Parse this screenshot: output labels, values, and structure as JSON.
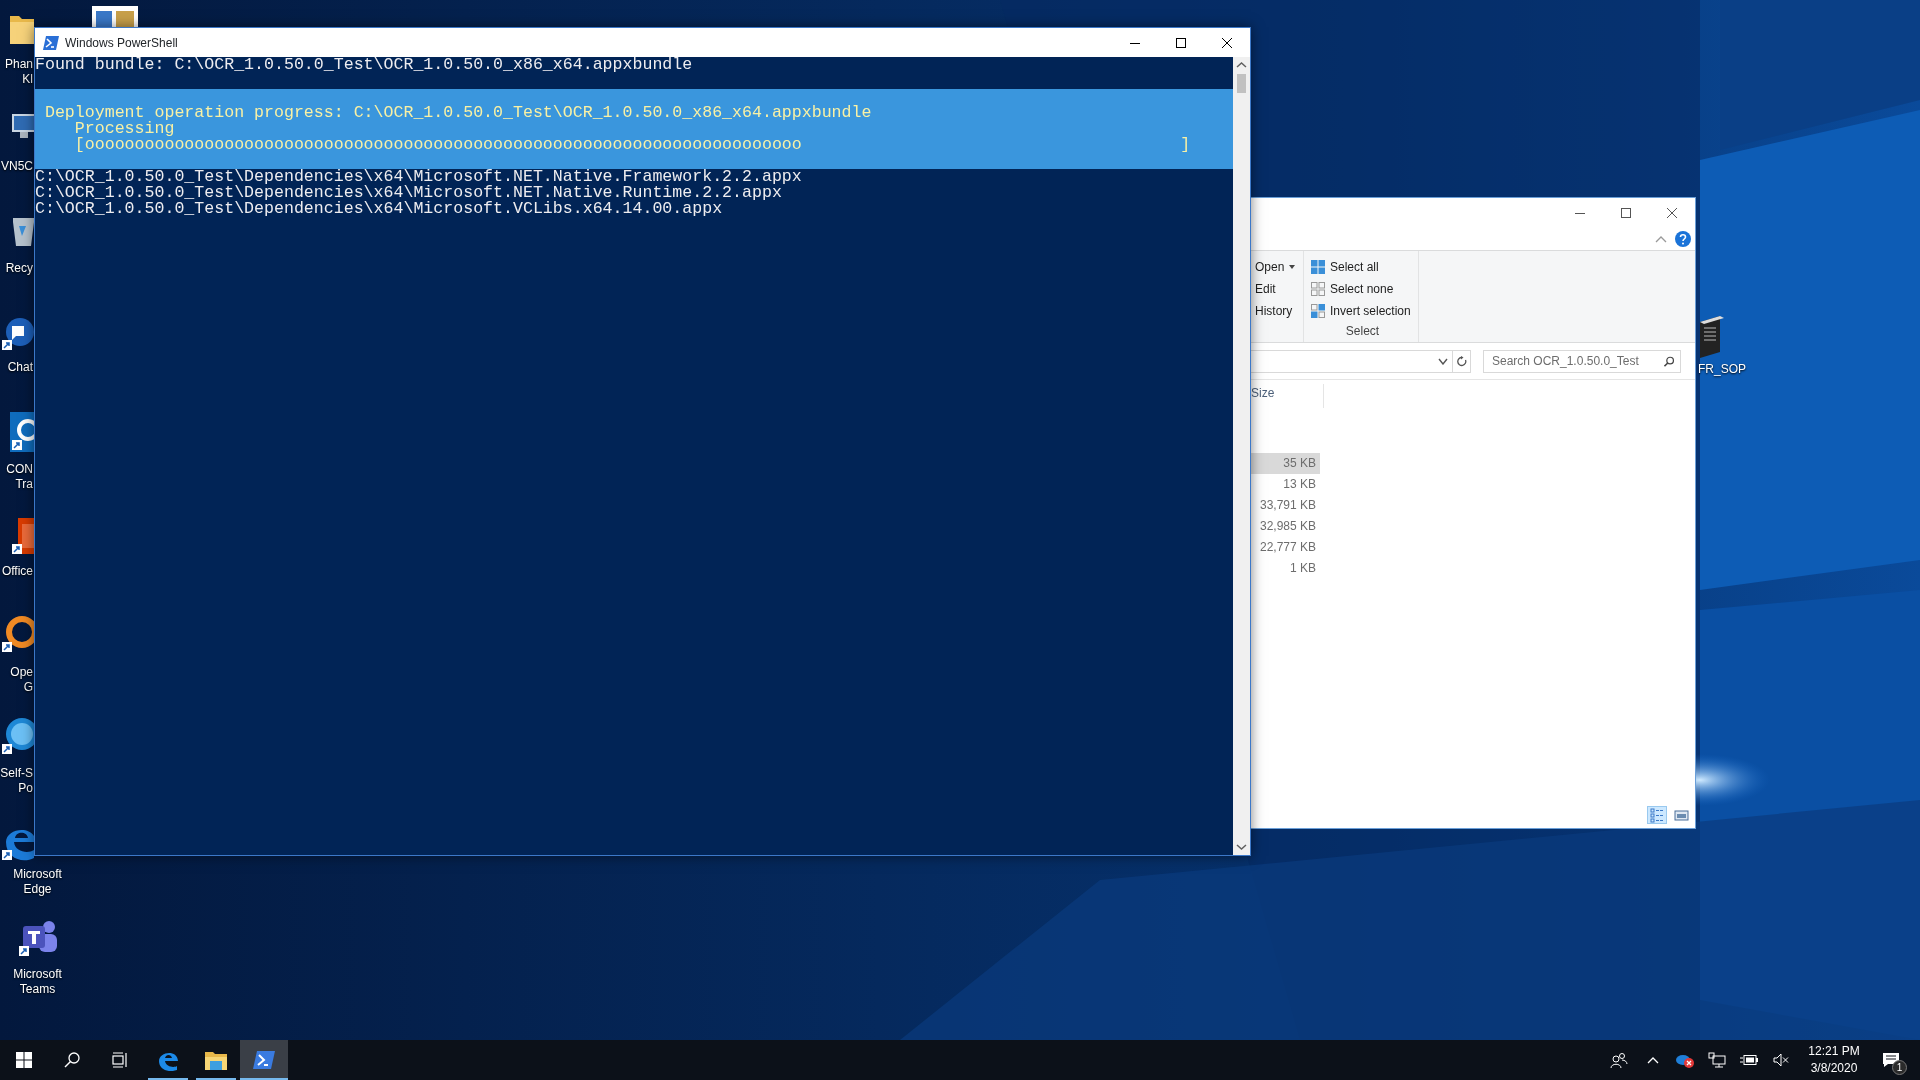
{
  "desktop": {
    "icons": [
      {
        "label_lines": [
          "Phan",
          "Kl"
        ]
      },
      {
        "label_lines": [
          "VN5C"
        ]
      },
      {
        "label_lines": [
          "Recy"
        ]
      },
      {
        "label_lines": [
          "Chat"
        ]
      },
      {
        "label_lines": [
          "CON",
          "Tra"
        ]
      },
      {
        "label_lines": [
          "Office"
        ]
      },
      {
        "label_lines": [
          "Ope",
          "G"
        ]
      },
      {
        "label_lines": [
          "Self-S",
          "Po"
        ]
      },
      {
        "label_lines": [
          "Microsoft",
          "Edge"
        ]
      },
      {
        "label_lines": [
          "Microsoft",
          "Teams"
        ]
      },
      {
        "label_lines": [
          "FR_SOP"
        ]
      }
    ]
  },
  "powershell": {
    "title": "Windows PowerShell",
    "lines_before": [
      "Found bundle: C:\\OCR_1.0.50.0_Test\\OCR_1.0.50.0_x86_x64.appxbundle"
    ],
    "progress": {
      "activity": "Deployment operation progress: C:\\OCR_1.0.50.0_Test\\OCR_1.0.50.0_x86_x64.appxbundle",
      "status": "Processing",
      "bar": "[oooooooooooooooooooooooooooooooooooooooooooooooooooooooooooooooooooooooo                                      ]"
    },
    "lines_after": [
      "C:\\OCR_1.0.50.0_Test\\Dependencies\\x64\\Microsoft.NET.Native.Framework.2.2.appx",
      "C:\\OCR_1.0.50.0_Test\\Dependencies\\x64\\Microsoft.NET.Native.Runtime.2.2.appx",
      "C:\\OCR_1.0.50.0_Test\\Dependencies\\x64\\Microsoft.VCLibs.x64.14.00.appx"
    ]
  },
  "explorer": {
    "open_group": [
      {
        "label": "Open",
        "has_menu": true
      },
      {
        "label": "Edit",
        "has_menu": false
      },
      {
        "label": "History",
        "has_menu": false
      }
    ],
    "select_group": {
      "label": "Select",
      "items": [
        {
          "kind": "all",
          "label": "Select all"
        },
        {
          "kind": "none",
          "label": "Select none"
        },
        {
          "kind": "invert",
          "label": "Invert selection"
        }
      ]
    },
    "search": {
      "placeholder": "Search OCR_1.0.50.0_Test"
    },
    "column": "Size",
    "rows": [
      {
        "size": "35 KB",
        "selected": true
      },
      {
        "size": "13 KB",
        "selected": false
      },
      {
        "size": "33,791 KB",
        "selected": false
      },
      {
        "size": "32,985 KB",
        "selected": false
      },
      {
        "size": "22,777 KB",
        "selected": false
      },
      {
        "size": "1 KB",
        "selected": false
      }
    ],
    "view_buttons": [
      {
        "kind": "details",
        "selected": true
      },
      {
        "kind": "large",
        "selected": false
      }
    ]
  },
  "taskbar": {
    "apps": [
      {
        "kind": "start",
        "running": false,
        "selected": false
      },
      {
        "kind": "search",
        "running": false,
        "selected": false
      },
      {
        "kind": "taskview",
        "running": false,
        "selected": false
      },
      {
        "kind": "browser",
        "running": true,
        "selected": false
      },
      {
        "kind": "folder",
        "running": true,
        "selected": false
      },
      {
        "kind": "terminal",
        "running": true,
        "selected": true
      }
    ],
    "time": "12:21 PM",
    "date": "3/8/2020",
    "notification_count": "1"
  }
}
